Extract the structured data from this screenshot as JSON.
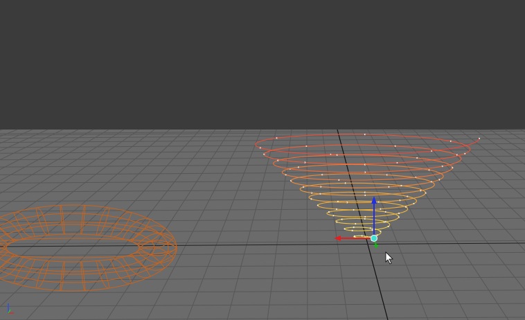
{
  "viewport": {
    "background_top": "#3b3b3b",
    "ground_color": "#6b6b6b",
    "grid_color": "#575757",
    "axis_line_color": "#111111"
  },
  "objects": {
    "spiral_curve": {
      "colors": [
        "#e8473a",
        "#f0a03a",
        "#f4e04a"
      ],
      "turns": 12,
      "selected": true
    },
    "torus_wireframe": {
      "color": "#c8641e",
      "selected": false
    }
  },
  "gizmo": {
    "icon": "move-manipulator-icon",
    "colors": {
      "x": "#e02020",
      "y": "#1fb020",
      "z": "#2030e0",
      "center": "#40e0d0"
    }
  },
  "cursor": {
    "icon": "mouse-pointer-icon"
  },
  "view_axis": {
    "icon": "view-axis-indicator-icon"
  }
}
